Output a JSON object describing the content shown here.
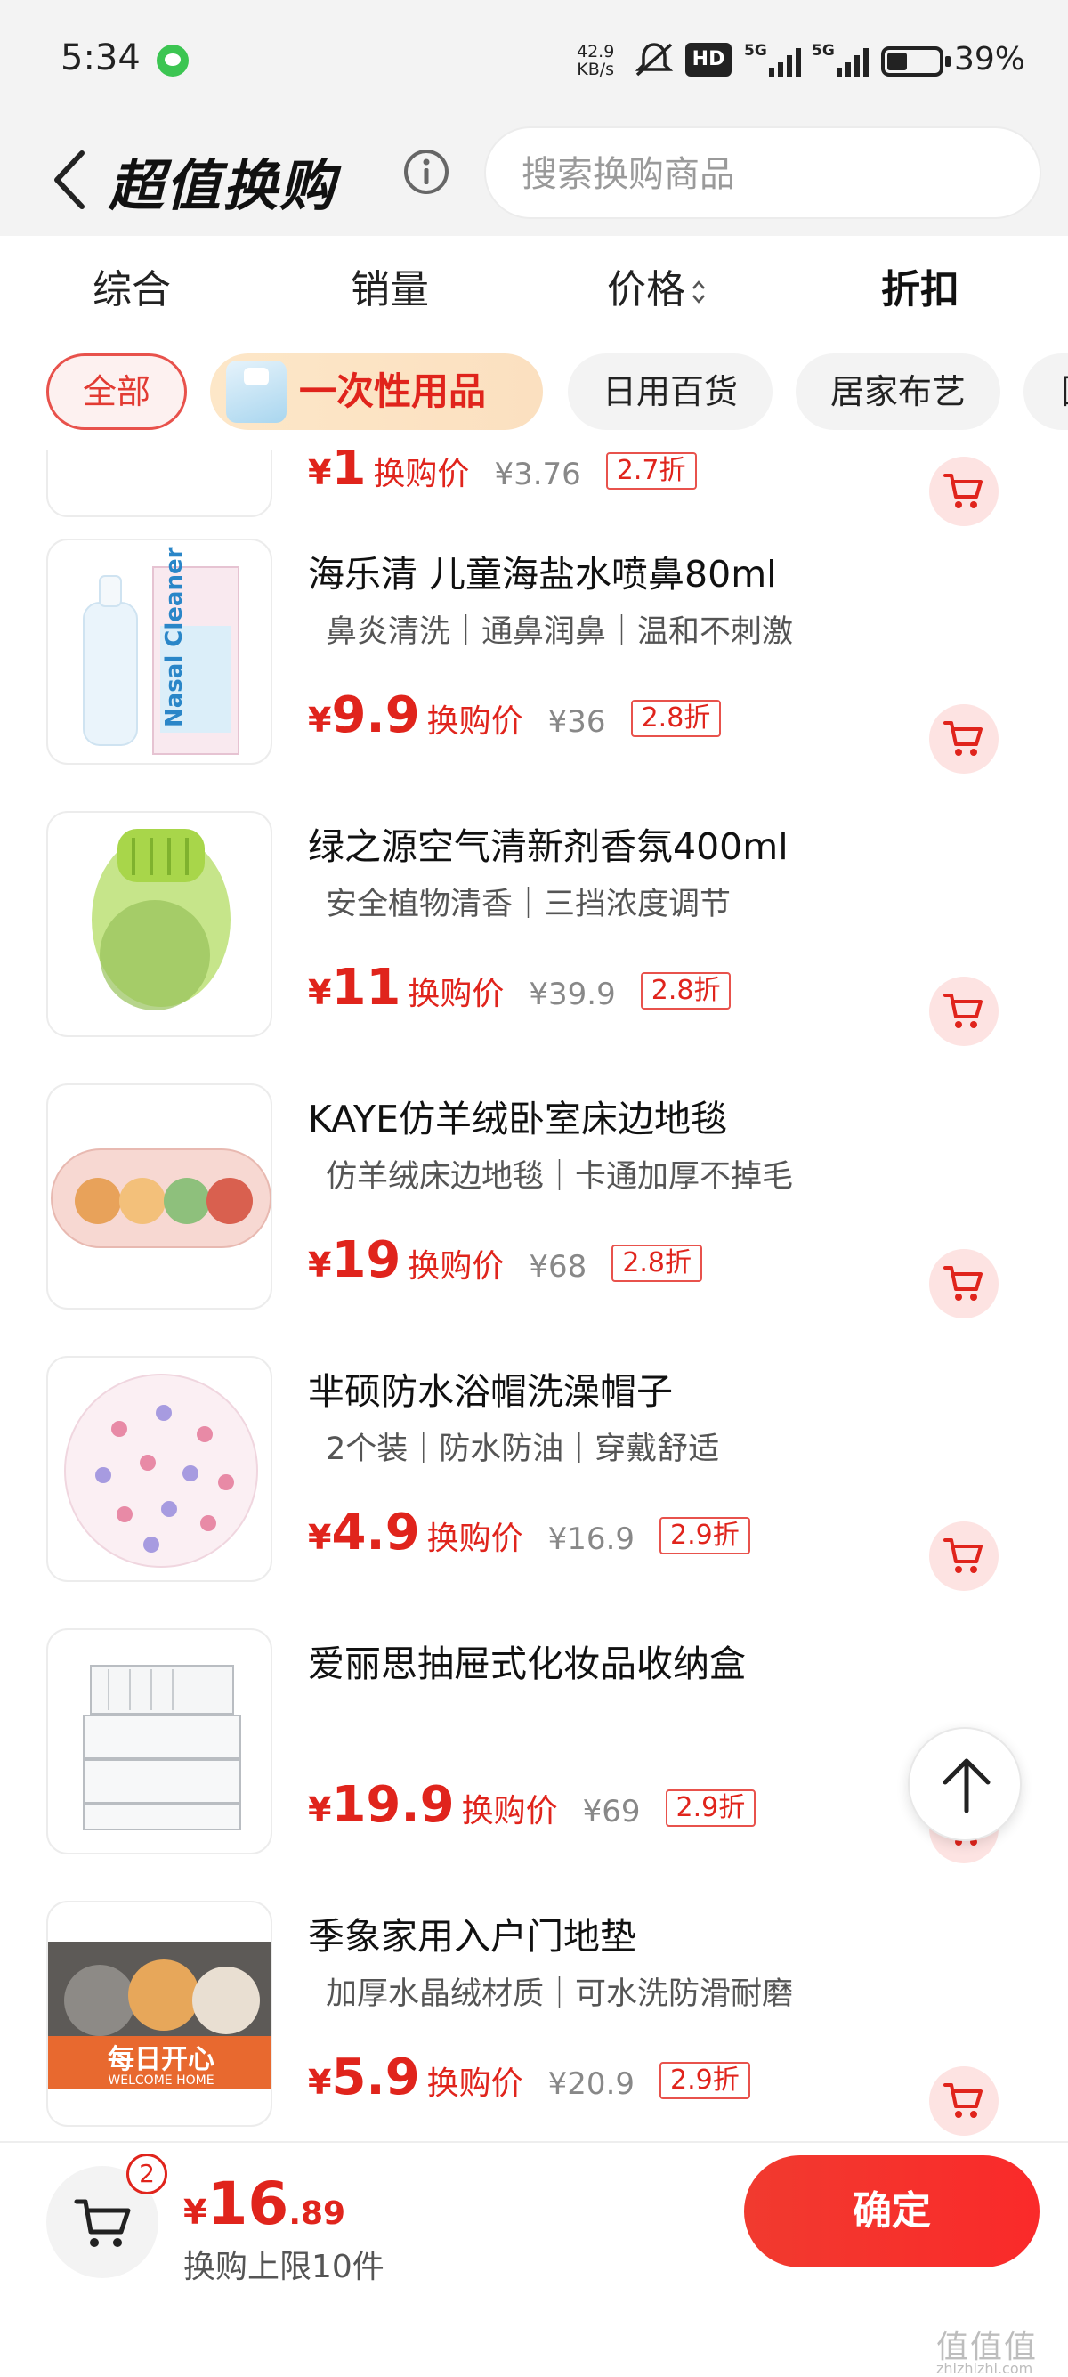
{
  "status_bar": {
    "time": "5:34",
    "net_speed_value": "42.9",
    "net_speed_unit": "KB/s",
    "hd_label": "HD",
    "signal_1": "5G",
    "signal_2": "5G",
    "battery_text": "39%",
    "battery_level": 0.39
  },
  "header": {
    "title": "超值换购",
    "search_placeholder": "搜索换购商品"
  },
  "sort_tabs": [
    {
      "label": "综合",
      "active": false
    },
    {
      "label": "销量",
      "active": false
    },
    {
      "label": "价格",
      "active": false
    },
    {
      "label": "折扣",
      "active": true
    }
  ],
  "categories": [
    {
      "label": "全部",
      "active": true
    },
    {
      "label": "一次性用品",
      "featured": true
    },
    {
      "label": "日用百货"
    },
    {
      "label": "居家布艺"
    },
    {
      "label": "国"
    }
  ],
  "products": [
    {
      "name": "",
      "tags": "",
      "price": "1",
      "price_label": "换购价",
      "original_price": "¥3.76",
      "discount": "2.7折"
    },
    {
      "name": "海乐清 儿童海盐水喷鼻80ml",
      "tags": "鼻炎清洗｜通鼻润鼻｜温和不刺激",
      "price": "9.9",
      "price_label": "换购价",
      "original_price": "¥36",
      "discount": "2.8折",
      "image_text": "Nasal Cleaner"
    },
    {
      "name": "绿之源空气清新剂香氛400ml",
      "tags": "安全植物清香｜三挡浓度调节",
      "price": "11",
      "price_label": "换购价",
      "original_price": "¥39.9",
      "discount": "2.8折"
    },
    {
      "name": "KAYE仿羊绒卧室床边地毯",
      "tags": "仿羊绒床边地毯｜卡通加厚不掉毛",
      "price": "19",
      "price_label": "换购价",
      "original_price": "¥68",
      "discount": "2.8折"
    },
    {
      "name": "芈硕防水浴帽洗澡帽子",
      "tags": "2个装｜防水防油｜穿戴舒适",
      "price": "4.9",
      "price_label": "换购价",
      "original_price": "¥16.9",
      "discount": "2.9折"
    },
    {
      "name": "爱丽思抽屉式化妆品收纳盒",
      "tags": "",
      "price": "19.9",
      "price_label": "换购价",
      "original_price": "¥69",
      "discount": "2.9折"
    },
    {
      "name": "季象家用入户门地垫",
      "tags": "加厚水晶绒材质｜可水洗防滑耐磨",
      "price": "5.9",
      "price_label": "换购价",
      "original_price": "¥20.9",
      "discount": "2.9折",
      "image_text": "每日开心",
      "image_subtext": "WELCOME HOME"
    }
  ],
  "bottom_bar": {
    "cart_count": "2",
    "total_currency": "¥",
    "total_int": "16",
    "total_dec": ".89",
    "limit_text": "换购上限10件",
    "confirm_label": "确定"
  },
  "watermark": {
    "text": "值值值",
    "sub": "zhizhizhi.com"
  },
  "colors": {
    "accent": "#e0241c",
    "chip_active_border": "#e8524c",
    "cart_bg": "#fde3e2",
    "header_bg": "#f3f3f3"
  },
  "icons": [
    "back-icon",
    "info-icon",
    "cart-icon",
    "arrow-up-icon",
    "sort-arrows-icon",
    "wechat-icon",
    "mute-icon",
    "signal-icon",
    "battery-icon"
  ]
}
